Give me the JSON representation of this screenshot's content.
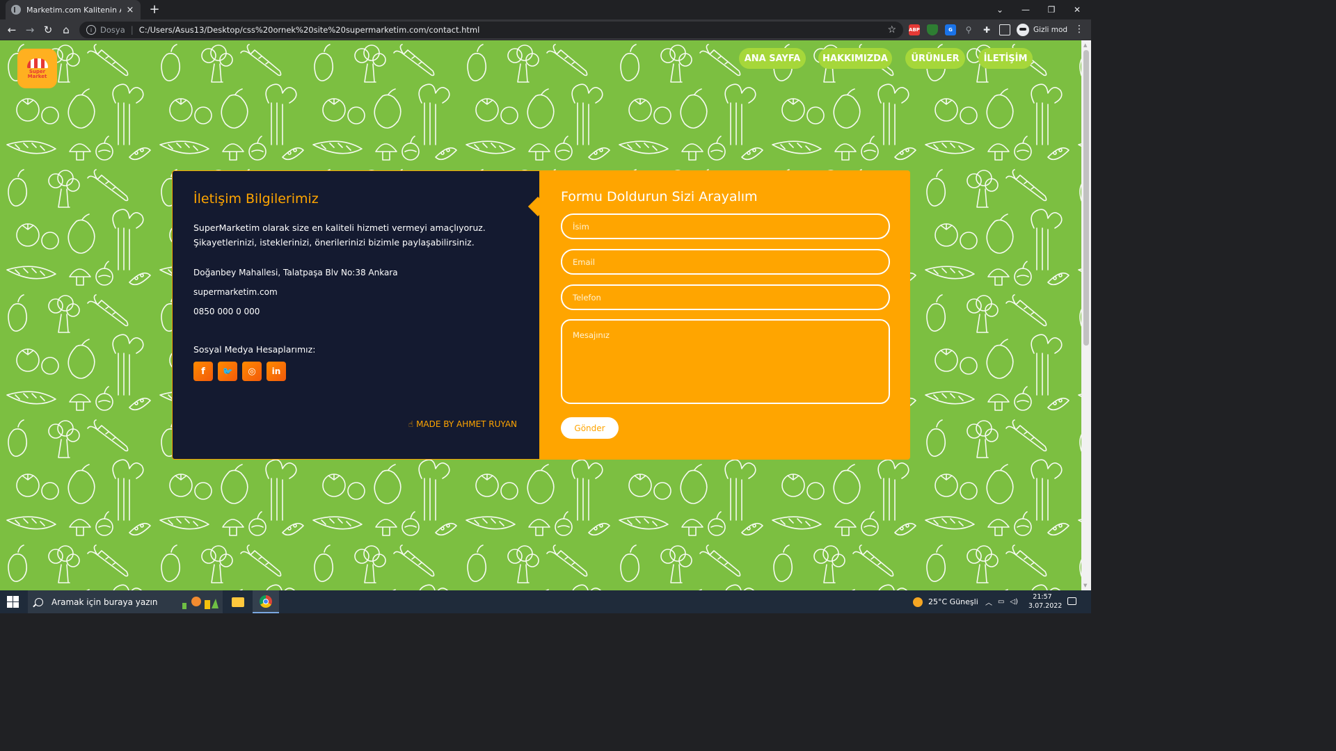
{
  "browser": {
    "tab_title": "Marketim.com Kalitenin Adresi S",
    "tab_close": "×",
    "new_tab": "+",
    "window_controls": [
      "⌄",
      "—",
      "❐",
      "✕"
    ],
    "scheme_label": "Dosya",
    "url": "C:/Users/Asus13/Desktop/css%20ornek%20site%20supermarketim.com/contact.html",
    "profile_label": "Gizli mod",
    "extensions": [
      {
        "label": "ABP",
        "color": "#e53935"
      },
      {
        "label": "",
        "color": "#2e7d32"
      },
      {
        "label": "G",
        "color": "#1a73e8"
      },
      {
        "label": "",
        "color": "#5f6368"
      },
      {
        "label": "",
        "color": "#5f6368"
      },
      {
        "label": "",
        "color": "#5f6368"
      }
    ]
  },
  "site": {
    "logo": {
      "line1": "Super",
      "line2": "Market"
    },
    "nav": [
      "ANA SAYFA",
      "HAKKIMIZDA",
      "ÜRÜNLER",
      "İLETİŞİM"
    ],
    "contact_info": {
      "title": "İletişim Bilgilerimiz",
      "intro": "SuperMarketim olarak size en kaliteli hizmeti vermeyi amaçlıyoruz. Şikayetlerinizi, isteklerinizi, önerilerinizi bizimle paylaşabilirsiniz.",
      "address": "Doğanbey Mahallesi, Talatpaşa Blv No:38 Ankara",
      "website": "supermarketim.com",
      "phone": "0850 000 0 000",
      "social_title": "Sosyal Medya Hesaplarımız:",
      "social": [
        {
          "name": "facebook",
          "glyph": "f"
        },
        {
          "name": "twitter",
          "glyph": "🐦"
        },
        {
          "name": "instagram",
          "glyph": "◎"
        },
        {
          "name": "linkedin",
          "glyph": "in"
        }
      ],
      "made_by": "MADE BY AHMET RUYAN"
    },
    "form": {
      "title": "Formu Doldurun Sizi Arayalım",
      "name_placeholder": "İsim",
      "email_placeholder": "Email",
      "phone_placeholder": "Telefon",
      "message_placeholder": "Mesajınız",
      "submit": "Gönder"
    },
    "colors": {
      "background_green": "#7cbf41",
      "nav_green": "#a6d73a",
      "accent_orange": "#ffa500",
      "dark_panel": "#141a30"
    }
  },
  "taskbar": {
    "search_placeholder": "Aramak için buraya yazın",
    "weather": "25°C  Güneşli",
    "time": "21:57",
    "date": "3.07.2022"
  }
}
